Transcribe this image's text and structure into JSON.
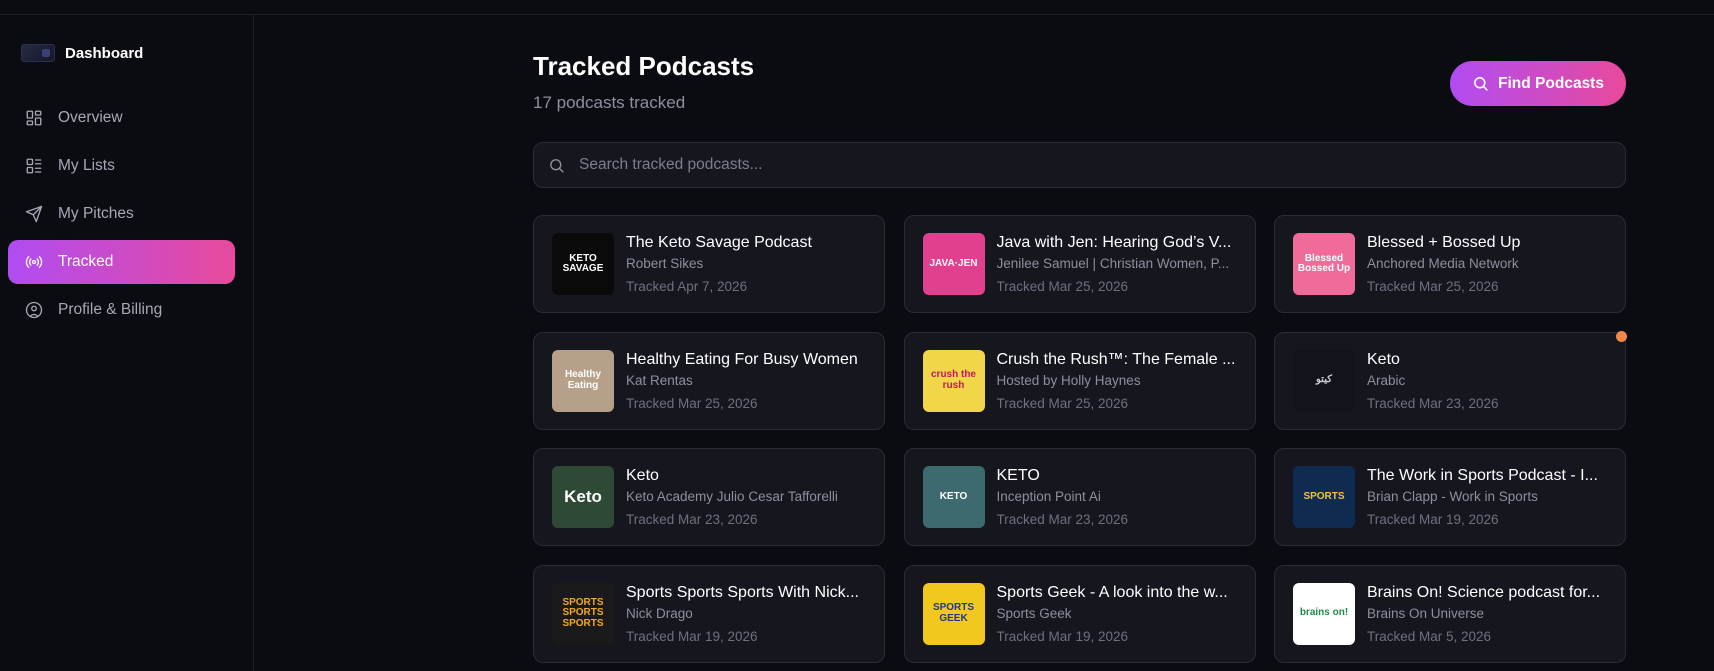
{
  "sidebar": {
    "brand": "Dashboard",
    "items": [
      {
        "label": "Overview",
        "icon": "grid-icon"
      },
      {
        "label": "My Lists",
        "icon": "list-icon"
      },
      {
        "label": "My Pitches",
        "icon": "send-icon"
      },
      {
        "label": "Tracked",
        "icon": "broadcast-icon",
        "active": true
      },
      {
        "label": "Profile & Billing",
        "icon": "user-circle-icon"
      }
    ]
  },
  "header": {
    "title": "Tracked Podcasts",
    "subtitle": "17 podcasts tracked",
    "find_button": "Find Podcasts"
  },
  "search": {
    "placeholder": "Search tracked podcasts..."
  },
  "podcasts": [
    {
      "title": "The Keto Savage Podcast",
      "author": "Robert Sikes",
      "tracked": "Tracked Apr 7, 2026",
      "thumb_text": "KETO SAVAGE",
      "thumb_bg": "#0a0a0a",
      "thumb_fg": "#ffffff"
    },
    {
      "title": "Java with Jen: Hearing God’s V...",
      "author": "Jenilee Samuel | Christian Women, P...",
      "tracked": "Tracked Mar 25, 2026",
      "thumb_text": "JAVA·JEN",
      "thumb_bg": "#e0408e",
      "thumb_fg": "#ffffff"
    },
    {
      "title": "Blessed + Bossed Up",
      "author": "Anchored Media Network",
      "tracked": "Tracked Mar 25, 2026",
      "thumb_text": "Blessed Bossed Up",
      "thumb_bg": "#f06b9a",
      "thumb_fg": "#ffffff"
    },
    {
      "title": "Healthy Eating For Busy Women",
      "author": "Kat Rentas",
      "tracked": "Tracked Mar 25, 2026",
      "thumb_text": "Healthy Eating",
      "thumb_bg": "#b7a08a",
      "thumb_fg": "#ffffff"
    },
    {
      "title": "Crush the Rush™: The Female ...",
      "author": "Hosted by Holly Haynes",
      "tracked": "Tracked Mar 25, 2026",
      "thumb_text": "crush the rush",
      "thumb_bg": "#f2d64a",
      "thumb_fg": "#c2185b"
    },
    {
      "title": "Keto",
      "author": "Arabic",
      "tracked": "Tracked Mar 23, 2026",
      "thumb_text": "كيتو",
      "thumb_bg": "#12141c",
      "thumb_fg": "#c9cbd6"
    },
    {
      "title": "Keto",
      "author": "Keto Academy Julio Cesar Tafforelli",
      "tracked": "Tracked Mar 23, 2026",
      "thumb_text": "Keto",
      "thumb_bg": "#2f4a34",
      "thumb_fg": "#ffffff"
    },
    {
      "title": "KETO",
      "author": "Inception Point Ai",
      "tracked": "Tracked Mar 23, 2026",
      "thumb_text": "KETO",
      "thumb_bg": "#3d6a6e",
      "thumb_fg": "#ffffff"
    },
    {
      "title": "The Work in Sports Podcast - I...",
      "author": "Brian Clapp - Work in Sports",
      "tracked": "Tracked Mar 19, 2026",
      "thumb_text": "SPORTS",
      "thumb_bg": "#0f2b52",
      "thumb_fg": "#f3c340"
    },
    {
      "title": "Sports Sports Sports With Nick...",
      "author": "Nick Drago",
      "tracked": "Tracked Mar 19, 2026",
      "thumb_text": "SPORTS SPORTS SPORTS",
      "thumb_bg": "#1a1a1a",
      "thumb_fg": "#f2a72a"
    },
    {
      "title": "Sports Geek - A look into the w...",
      "author": "Sports Geek",
      "tracked": "Tracked Mar 19, 2026",
      "thumb_text": "SPORTS GEEK",
      "thumb_bg": "#f2c81e",
      "thumb_fg": "#1b3b8a"
    },
    {
      "title": "Brains On! Science podcast for...",
      "author": "Brains On Universe",
      "tracked": "Tracked Mar 5, 2026",
      "thumb_text": "brains on!",
      "thumb_bg": "#ffffff",
      "thumb_fg": "#1e8a4a"
    }
  ]
}
